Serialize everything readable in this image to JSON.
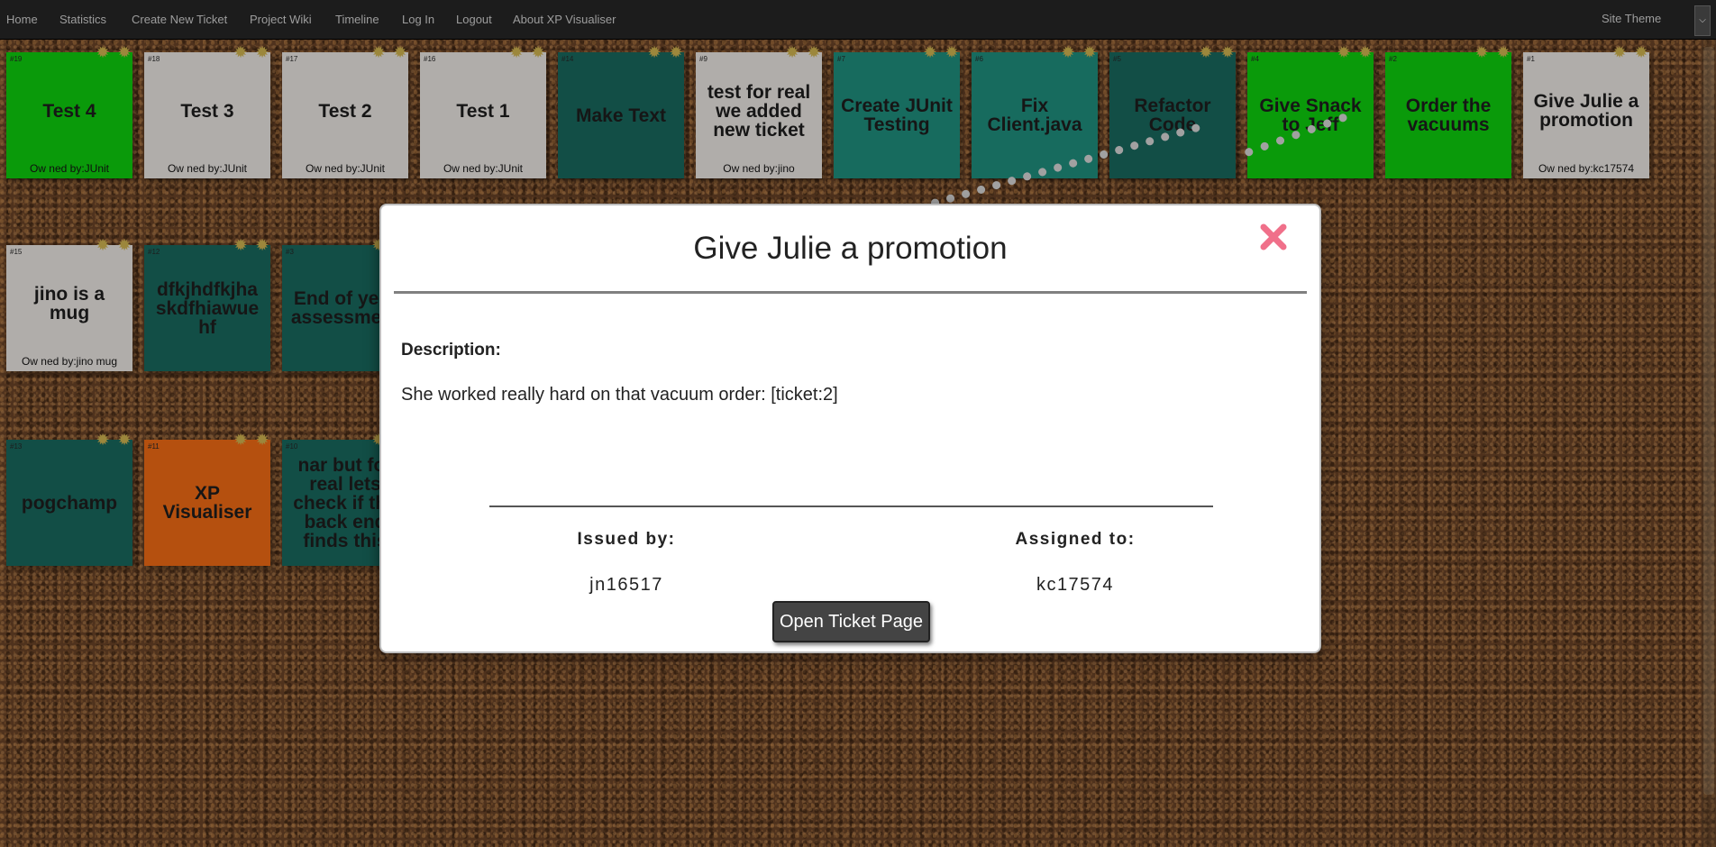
{
  "navbar": {
    "items": [
      "Home",
      "Statistics",
      "Create New Ticket",
      "Project Wiki",
      "Timeline",
      "Log In",
      "Logout",
      "About XP Visualiser"
    ],
    "theme_label": "Site Theme"
  },
  "tickets": [
    {
      "num": "#19",
      "title": "Test 4",
      "owner": "Ow ned by:JUnit",
      "color": "#0cb00c"
    },
    {
      "num": "#18",
      "title": "Test 3",
      "owner": "Ow ned by:JUnit",
      "color": "#c9c5c2"
    },
    {
      "num": "#17",
      "title": "Test 2",
      "owner": "Ow ned by:JUnit",
      "color": "#c9c5c2"
    },
    {
      "num": "#16",
      "title": "Test 1",
      "owner": "Ow ned by:JUnit",
      "color": "#c9c5c2"
    },
    {
      "num": "#14",
      "title": "Make Text",
      "owner": "",
      "color": "#155950"
    },
    {
      "num": "#9",
      "title": "test for real we added new ticket",
      "owner": "Ow ned by:jino",
      "color": "#c9c5c2"
    },
    {
      "num": "#7",
      "title": "Create JUnit Testing",
      "owner": "",
      "color": "#1b7a6c"
    },
    {
      "num": "#6",
      "title": "Fix Client.java",
      "owner": "",
      "color": "#1b7a6c"
    },
    {
      "num": "#5",
      "title": "Refactor Code",
      "owner": "",
      "color": "#155950"
    },
    {
      "num": "#4",
      "title": "Give Snack to Jeff",
      "owner": "",
      "color": "#0cb00c"
    },
    {
      "num": "#2",
      "title": "Order the vacuums",
      "owner": "",
      "color": "#0cb00c"
    },
    {
      "num": "#1",
      "title": "Give Julie a promotion",
      "owner": "Ow ned by:kc17574",
      "color": "#c9c5c2"
    },
    {
      "num": "#15",
      "title": "jino is a mug",
      "owner": "Ow ned by:jino mug",
      "color": "#c9c5c2"
    },
    {
      "num": "#12",
      "title": "dfkjhdfkjha skdfhiawue hf",
      "owner": "",
      "color": "#155950"
    },
    {
      "num": "#3",
      "title": "End of year assessment",
      "owner": "",
      "color": "#155950"
    },
    {
      "num": "#13",
      "title": "pogchamp",
      "owner": "",
      "color": "#155950"
    },
    {
      "num": "#11",
      "title": "XP Visualiser",
      "owner": "",
      "color": "#cf5c12"
    },
    {
      "num": "#10",
      "title": "nar but for real lets check if the back end finds this",
      "owner": "",
      "color": "#155950"
    }
  ],
  "modal": {
    "title": "Give Julie a promotion",
    "description_label": "Description:",
    "description": "She worked really hard on that vacuum order: [ticket:2]",
    "issued_by_label": "Issued by:",
    "issued_by": "jn16517",
    "assigned_to_label": "Assigned to:",
    "assigned_to": "kc17574",
    "open_button": "Open Ticket Page",
    "close_color": "#f0708a"
  }
}
